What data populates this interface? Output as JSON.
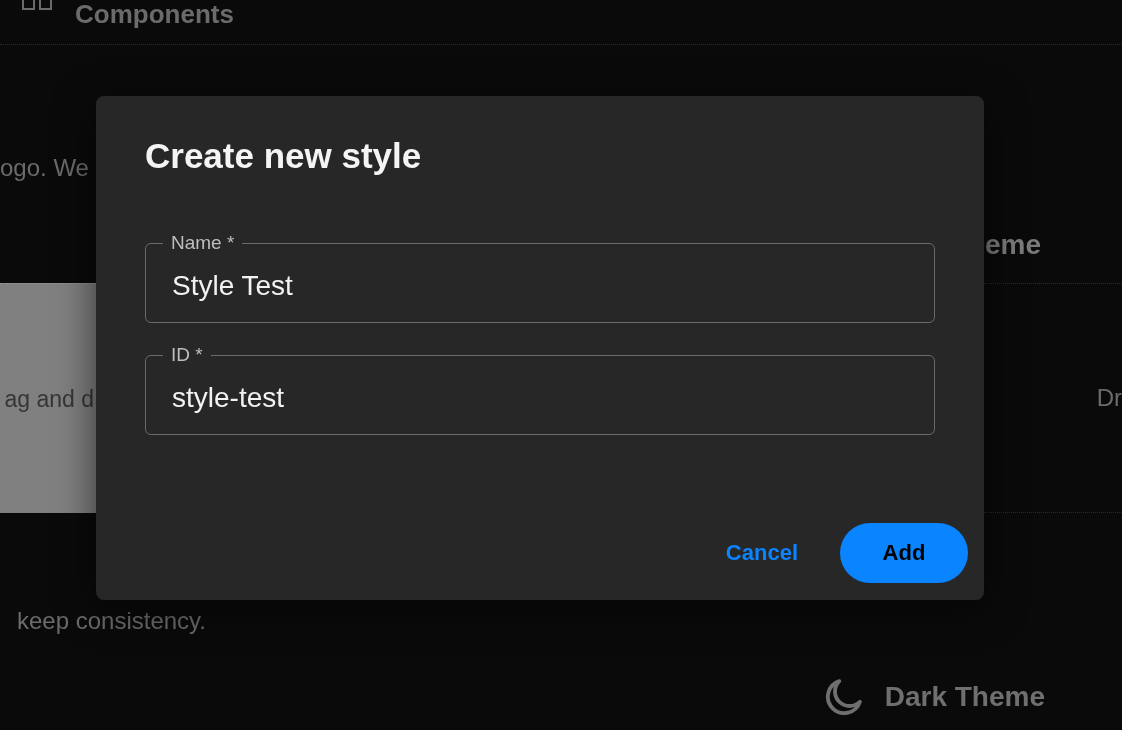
{
  "page": {
    "header": {
      "title": "Components"
    },
    "intro_text": "ogo. We",
    "heading": "eme",
    "drop_zone": {
      "text": "ag and d"
    },
    "side_text": "Dr",
    "footnote": "keep consistency.",
    "theme_toggle": {
      "label": "Dark Theme"
    }
  },
  "dialog": {
    "title": "Create new style",
    "fields": [
      {
        "label": "Name *",
        "value": "Style Test"
      },
      {
        "label": "ID *",
        "value": "style-test"
      }
    ],
    "buttons": [
      {
        "label": "Cancel",
        "kind": "text"
      },
      {
        "label": "Add",
        "kind": "filled"
      }
    ]
  }
}
